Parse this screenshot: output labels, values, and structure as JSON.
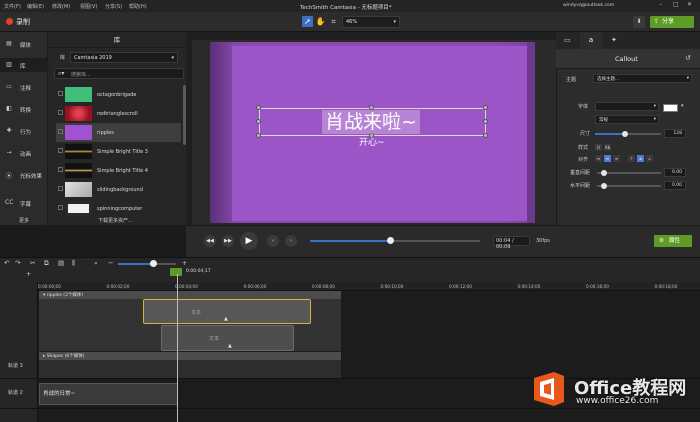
{
  "titlebar": {
    "menus": [
      "文件(F)",
      "编辑(E)",
      "修改(M)",
      "视图(V)",
      "分享(S)",
      "帮助(H)"
    ],
    "title": "TechSmith Camtasia - 无标题项目*",
    "user": "windyvq@outlook.com"
  },
  "toolbar": {
    "record_label": "录制",
    "zoom": "46%",
    "share_label": "分享"
  },
  "tools": [
    {
      "label": "媒体",
      "icon": "media-icon"
    },
    {
      "label": "库",
      "icon": "library-icon"
    },
    {
      "label": "注释",
      "icon": "annotation-icon"
    },
    {
      "label": "转换",
      "icon": "transition-icon"
    },
    {
      "label": "行为",
      "icon": "behavior-icon"
    },
    {
      "label": "动画",
      "icon": "animation-icon"
    },
    {
      "label": "光标效果",
      "icon": "cursor-effect-icon"
    },
    {
      "label": "字幕",
      "icon": "captions-icon"
    }
  ],
  "more_label": "更多",
  "library": {
    "title": "库",
    "select_label": "库",
    "selected": "Camtasia 2019",
    "search_placeholder": "搜索库...",
    "assets": [
      {
        "name": "octagonbrigade",
        "thumb": "#3fbf7a"
      },
      {
        "name": "redtrianglescroll",
        "thumb": "#c8202e"
      },
      {
        "name": "ripples",
        "thumb": "#a252d0"
      },
      {
        "name": "Simple Bright Title 3",
        "thumb": "#111111"
      },
      {
        "name": "Simple Bright Title 4",
        "thumb": "#111111"
      },
      {
        "name": "slidingbackground",
        "thumb": "#cfcfcf"
      },
      {
        "name": "spinningcomputer",
        "thumb": "#e8e8e8"
      }
    ],
    "more_assets": "下载更多资产..."
  },
  "canvas": {
    "callout_text": "肖战来啦~",
    "sub_text": "开心~",
    "video_color": "#a45ecd"
  },
  "props": {
    "tabs": [
      "▭",
      "a",
      "✦"
    ],
    "title": "Callout",
    "theme_label": "主题",
    "theme_value": "选择主题...",
    "font_label": "字体",
    "style_value": "常规",
    "size_label": "尺寸",
    "size_value": "128",
    "format_label": "样式",
    "align_label": "对齐",
    "vspace_label": "垂直间距",
    "vspace_value": "0.00",
    "hspace_label": "水平间距",
    "hspace_value": "0.00"
  },
  "playback": {
    "time": "00:04 / 00:09",
    "fps": "30fps",
    "props_label": "属性",
    "progress": 0.47
  },
  "timeline": {
    "playhead_time": "0:00:04;17",
    "ruler": [
      "0:00:00;00",
      "0:00:02;00",
      "0:00:04;00",
      "0:00:06;00",
      "0:00:08;00",
      "0:00:10;00",
      "0:00:12;00",
      "0:00:14;00",
      "0:00:16;00",
      "0:00:18;00",
      "0:00:20;00"
    ],
    "group1": "ripples (2个媒体)",
    "clip_label": "文本",
    "group2": "Shapes (6个媒体)",
    "track3": "轨道 3",
    "track2": "轨道 2",
    "track2_clip": "肖战的日常~"
  },
  "watermark": {
    "title": "Office教程网",
    "url": "www.office26.com"
  }
}
